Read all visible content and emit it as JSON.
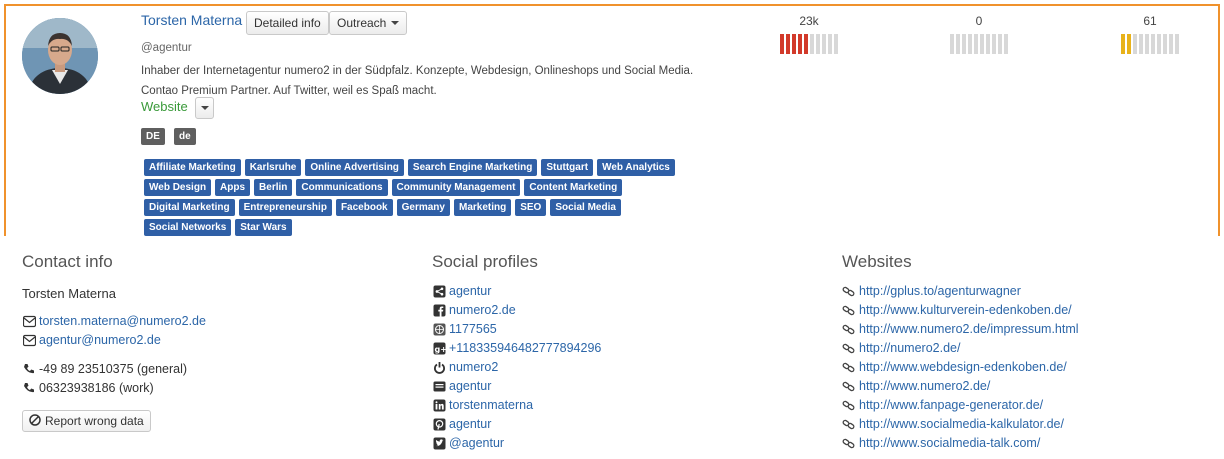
{
  "profile": {
    "name": "Torsten Materna",
    "handle": "@agentur",
    "bio_line1": "Inhaber der Internetagentur numero2 in der Südpfalz. Konzepte, Webdesign, Onlineshops und Social Media.",
    "bio_line2": "Contao Premium Partner. Auf Twitter, weil es Spaß macht.",
    "website_label": "Website",
    "detailed_info_label": "Detailed info",
    "outreach_label": "Outreach",
    "languages": [
      "DE",
      "de"
    ],
    "tags": [
      "Affiliate Marketing",
      "Karlsruhe",
      "Online Advertising",
      "Search Engine Marketing",
      "Stuttgart",
      "Web Analytics",
      "Web Design",
      "Apps",
      "Berlin",
      "Communications",
      "Community Management",
      "Content Marketing",
      "Digital Marketing",
      "Entrepreneurship",
      "Facebook",
      "Germany",
      "Marketing",
      "SEO",
      "Social Media",
      "Social Networks",
      "Star Wars"
    ]
  },
  "metrics": [
    {
      "value": "23k",
      "filled": 5,
      "total": 10,
      "color": "#d23a2a"
    },
    {
      "value": "0",
      "filled": 0,
      "total": 10,
      "color": "#d8d8d8"
    },
    {
      "value": "61",
      "filled": 2,
      "total": 10,
      "color": "#e8b21a"
    }
  ],
  "contact": {
    "title": "Contact info",
    "name": "Torsten Materna",
    "emails": [
      "torsten.materna@numero2.de",
      "agentur@numero2.de"
    ],
    "phones": [
      "-49 89 23510375 (general)",
      "06323938186 (work)"
    ],
    "report_label": "Report wrong data"
  },
  "social": {
    "title": "Social profiles",
    "items": [
      {
        "icon": "share-icon",
        "text": "agentur"
      },
      {
        "icon": "facebook-icon",
        "text": "numero2.de"
      },
      {
        "icon": "globe-icon",
        "text": "1177565"
      },
      {
        "icon": "google-plus-icon",
        "text": "+118335946482777894296"
      },
      {
        "icon": "power-icon",
        "text": "numero2"
      },
      {
        "icon": "profile-card-icon",
        "text": "agentur"
      },
      {
        "icon": "linkedin-icon",
        "text": "torstenmaterna"
      },
      {
        "icon": "pinterest-icon",
        "text": "agentur"
      },
      {
        "icon": "twitter-icon",
        "text": "@agentur"
      }
    ]
  },
  "websites": {
    "title": "Websites",
    "items": [
      "http://gplus.to/agenturwagner",
      "http://www.kulturverein-edenkoben.de/",
      "http://www.numero2.de/impressum.html",
      "http://numero2.de/",
      "http://www.webdesign-edenkoben.de/",
      "http://www.numero2.de/",
      "http://www.fanpage-generator.de/",
      "http://www.socialmedia-kalkulator.de/",
      "http://www.socialmedia-talk.com/"
    ]
  }
}
